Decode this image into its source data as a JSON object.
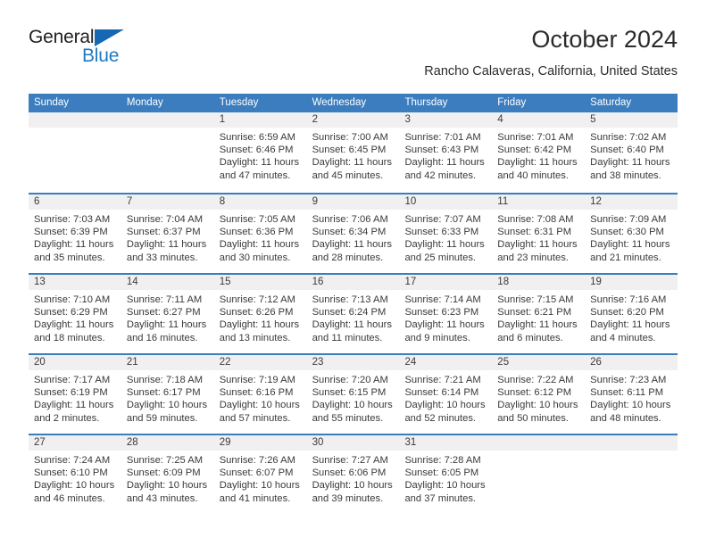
{
  "brand": {
    "name_top": "General",
    "name_bottom": "Blue",
    "color_dark": "#231f20",
    "color_blue": "#1f7ac4",
    "triangle_icon": "triangle-icon"
  },
  "header": {
    "month_title": "October 2024",
    "location": "Rancho Calaveras, California, United States"
  },
  "theme": {
    "header_blue": "#3b7dbf",
    "day_band_gray": "#f0f0f0",
    "text": "#3a3a3a"
  },
  "calendar": {
    "weekdays": [
      "Sunday",
      "Monday",
      "Tuesday",
      "Wednesday",
      "Thursday",
      "Friday",
      "Saturday"
    ],
    "weeks": [
      [
        {
          "day": "",
          "lines": []
        },
        {
          "day": "",
          "lines": []
        },
        {
          "day": "1",
          "lines": [
            "Sunrise: 6:59 AM",
            "Sunset: 6:46 PM",
            "Daylight: 11 hours",
            "and 47 minutes."
          ]
        },
        {
          "day": "2",
          "lines": [
            "Sunrise: 7:00 AM",
            "Sunset: 6:45 PM",
            "Daylight: 11 hours",
            "and 45 minutes."
          ]
        },
        {
          "day": "3",
          "lines": [
            "Sunrise: 7:01 AM",
            "Sunset: 6:43 PM",
            "Daylight: 11 hours",
            "and 42 minutes."
          ]
        },
        {
          "day": "4",
          "lines": [
            "Sunrise: 7:01 AM",
            "Sunset: 6:42 PM",
            "Daylight: 11 hours",
            "and 40 minutes."
          ]
        },
        {
          "day": "5",
          "lines": [
            "Sunrise: 7:02 AM",
            "Sunset: 6:40 PM",
            "Daylight: 11 hours",
            "and 38 minutes."
          ]
        }
      ],
      [
        {
          "day": "6",
          "lines": [
            "Sunrise: 7:03 AM",
            "Sunset: 6:39 PM",
            "Daylight: 11 hours",
            "and 35 minutes."
          ]
        },
        {
          "day": "7",
          "lines": [
            "Sunrise: 7:04 AM",
            "Sunset: 6:37 PM",
            "Daylight: 11 hours",
            "and 33 minutes."
          ]
        },
        {
          "day": "8",
          "lines": [
            "Sunrise: 7:05 AM",
            "Sunset: 6:36 PM",
            "Daylight: 11 hours",
            "and 30 minutes."
          ]
        },
        {
          "day": "9",
          "lines": [
            "Sunrise: 7:06 AM",
            "Sunset: 6:34 PM",
            "Daylight: 11 hours",
            "and 28 minutes."
          ]
        },
        {
          "day": "10",
          "lines": [
            "Sunrise: 7:07 AM",
            "Sunset: 6:33 PM",
            "Daylight: 11 hours",
            "and 25 minutes."
          ]
        },
        {
          "day": "11",
          "lines": [
            "Sunrise: 7:08 AM",
            "Sunset: 6:31 PM",
            "Daylight: 11 hours",
            "and 23 minutes."
          ]
        },
        {
          "day": "12",
          "lines": [
            "Sunrise: 7:09 AM",
            "Sunset: 6:30 PM",
            "Daylight: 11 hours",
            "and 21 minutes."
          ]
        }
      ],
      [
        {
          "day": "13",
          "lines": [
            "Sunrise: 7:10 AM",
            "Sunset: 6:29 PM",
            "Daylight: 11 hours",
            "and 18 minutes."
          ]
        },
        {
          "day": "14",
          "lines": [
            "Sunrise: 7:11 AM",
            "Sunset: 6:27 PM",
            "Daylight: 11 hours",
            "and 16 minutes."
          ]
        },
        {
          "day": "15",
          "lines": [
            "Sunrise: 7:12 AM",
            "Sunset: 6:26 PM",
            "Daylight: 11 hours",
            "and 13 minutes."
          ]
        },
        {
          "day": "16",
          "lines": [
            "Sunrise: 7:13 AM",
            "Sunset: 6:24 PM",
            "Daylight: 11 hours",
            "and 11 minutes."
          ]
        },
        {
          "day": "17",
          "lines": [
            "Sunrise: 7:14 AM",
            "Sunset: 6:23 PM",
            "Daylight: 11 hours",
            "and 9 minutes."
          ]
        },
        {
          "day": "18",
          "lines": [
            "Sunrise: 7:15 AM",
            "Sunset: 6:21 PM",
            "Daylight: 11 hours",
            "and 6 minutes."
          ]
        },
        {
          "day": "19",
          "lines": [
            "Sunrise: 7:16 AM",
            "Sunset: 6:20 PM",
            "Daylight: 11 hours",
            "and 4 minutes."
          ]
        }
      ],
      [
        {
          "day": "20",
          "lines": [
            "Sunrise: 7:17 AM",
            "Sunset: 6:19 PM",
            "Daylight: 11 hours",
            "and 2 minutes."
          ]
        },
        {
          "day": "21",
          "lines": [
            "Sunrise: 7:18 AM",
            "Sunset: 6:17 PM",
            "Daylight: 10 hours",
            "and 59 minutes."
          ]
        },
        {
          "day": "22",
          "lines": [
            "Sunrise: 7:19 AM",
            "Sunset: 6:16 PM",
            "Daylight: 10 hours",
            "and 57 minutes."
          ]
        },
        {
          "day": "23",
          "lines": [
            "Sunrise: 7:20 AM",
            "Sunset: 6:15 PM",
            "Daylight: 10 hours",
            "and 55 minutes."
          ]
        },
        {
          "day": "24",
          "lines": [
            "Sunrise: 7:21 AM",
            "Sunset: 6:14 PM",
            "Daylight: 10 hours",
            "and 52 minutes."
          ]
        },
        {
          "day": "25",
          "lines": [
            "Sunrise: 7:22 AM",
            "Sunset: 6:12 PM",
            "Daylight: 10 hours",
            "and 50 minutes."
          ]
        },
        {
          "day": "26",
          "lines": [
            "Sunrise: 7:23 AM",
            "Sunset: 6:11 PM",
            "Daylight: 10 hours",
            "and 48 minutes."
          ]
        }
      ],
      [
        {
          "day": "27",
          "lines": [
            "Sunrise: 7:24 AM",
            "Sunset: 6:10 PM",
            "Daylight: 10 hours",
            "and 46 minutes."
          ]
        },
        {
          "day": "28",
          "lines": [
            "Sunrise: 7:25 AM",
            "Sunset: 6:09 PM",
            "Daylight: 10 hours",
            "and 43 minutes."
          ]
        },
        {
          "day": "29",
          "lines": [
            "Sunrise: 7:26 AM",
            "Sunset: 6:07 PM",
            "Daylight: 10 hours",
            "and 41 minutes."
          ]
        },
        {
          "day": "30",
          "lines": [
            "Sunrise: 7:27 AM",
            "Sunset: 6:06 PM",
            "Daylight: 10 hours",
            "and 39 minutes."
          ]
        },
        {
          "day": "31",
          "lines": [
            "Sunrise: 7:28 AM",
            "Sunset: 6:05 PM",
            "Daylight: 10 hours",
            "and 37 minutes."
          ]
        },
        {
          "day": "",
          "lines": []
        },
        {
          "day": "",
          "lines": []
        }
      ]
    ]
  }
}
